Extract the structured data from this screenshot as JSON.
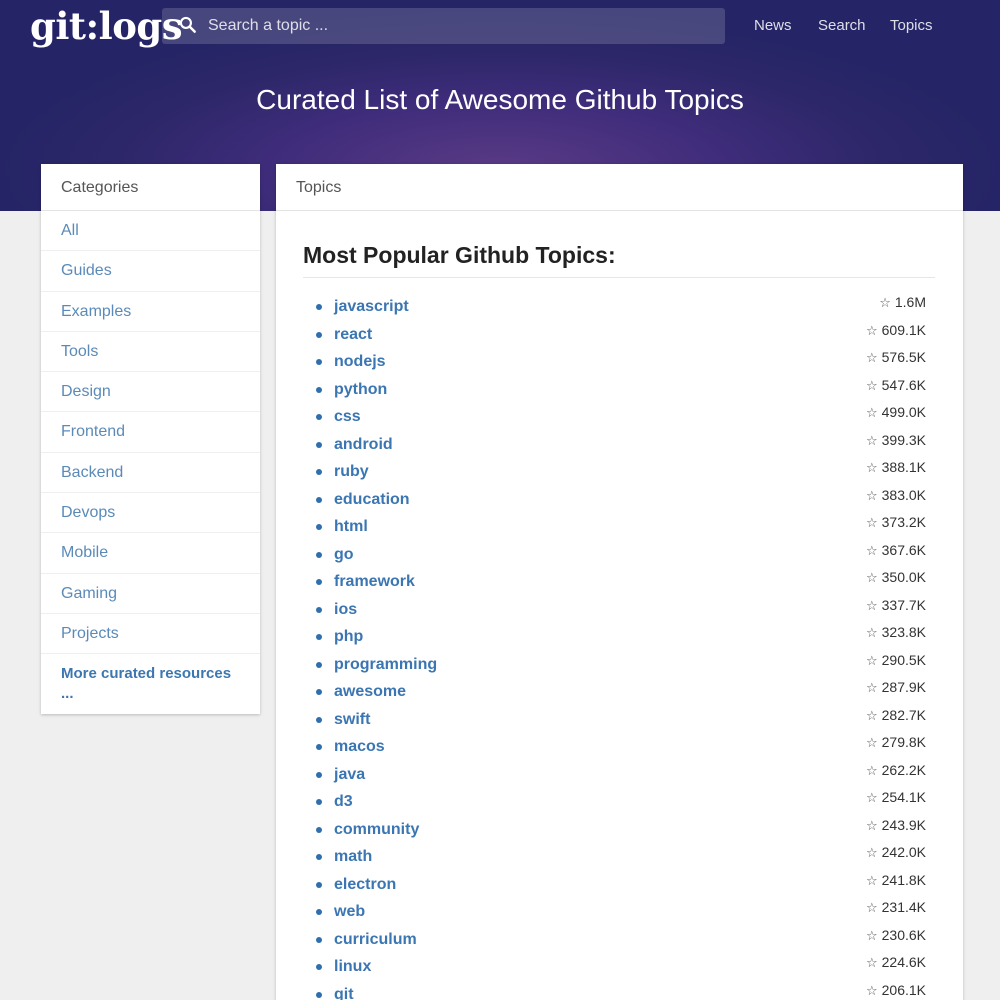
{
  "header": {
    "logo": "git:logs",
    "search_placeholder": "Search a topic ...",
    "nav": [
      "News",
      "Search",
      "Topics"
    ],
    "title": "Curated List of Awesome Github Topics"
  },
  "sidebar": {
    "title": "Categories",
    "items": [
      "All",
      "Guides",
      "Examples",
      "Tools",
      "Design",
      "Frontend",
      "Backend",
      "Devops",
      "Mobile",
      "Gaming",
      "Projects"
    ],
    "more": "More curated resources ..."
  },
  "main": {
    "title": "Topics",
    "heading": "Most Popular Github Topics:",
    "topics": [
      {
        "name": "javascript",
        "stars": "1.6M"
      },
      {
        "name": "react",
        "stars": "609.1K"
      },
      {
        "name": "nodejs",
        "stars": "576.5K"
      },
      {
        "name": "python",
        "stars": "547.6K"
      },
      {
        "name": "css",
        "stars": "499.0K"
      },
      {
        "name": "android",
        "stars": "399.3K"
      },
      {
        "name": "ruby",
        "stars": "388.1K"
      },
      {
        "name": "education",
        "stars": "383.0K"
      },
      {
        "name": "html",
        "stars": "373.2K"
      },
      {
        "name": "go",
        "stars": "367.6K"
      },
      {
        "name": "framework",
        "stars": "350.0K"
      },
      {
        "name": "ios",
        "stars": "337.7K"
      },
      {
        "name": "php",
        "stars": "323.8K"
      },
      {
        "name": "programming",
        "stars": "290.5K"
      },
      {
        "name": "awesome",
        "stars": "287.9K"
      },
      {
        "name": "swift",
        "stars": "282.7K"
      },
      {
        "name": "macos",
        "stars": "279.8K"
      },
      {
        "name": "java",
        "stars": "262.2K"
      },
      {
        "name": "d3",
        "stars": "254.1K"
      },
      {
        "name": "community",
        "stars": "243.9K"
      },
      {
        "name": "math",
        "stars": "242.0K"
      },
      {
        "name": "electron",
        "stars": "241.8K"
      },
      {
        "name": "web",
        "stars": "231.4K"
      },
      {
        "name": "curriculum",
        "stars": "230.6K"
      },
      {
        "name": "linux",
        "stars": "224.6K"
      },
      {
        "name": "git",
        "stars": "206.1K"
      }
    ]
  },
  "icons": {
    "search": "search-icon",
    "star": "star-outline-icon"
  },
  "colors": {
    "header_bg": "#2c2768",
    "link": "#3b76b2",
    "category_link": "#5b8ab8",
    "page_bg": "#efefef"
  }
}
